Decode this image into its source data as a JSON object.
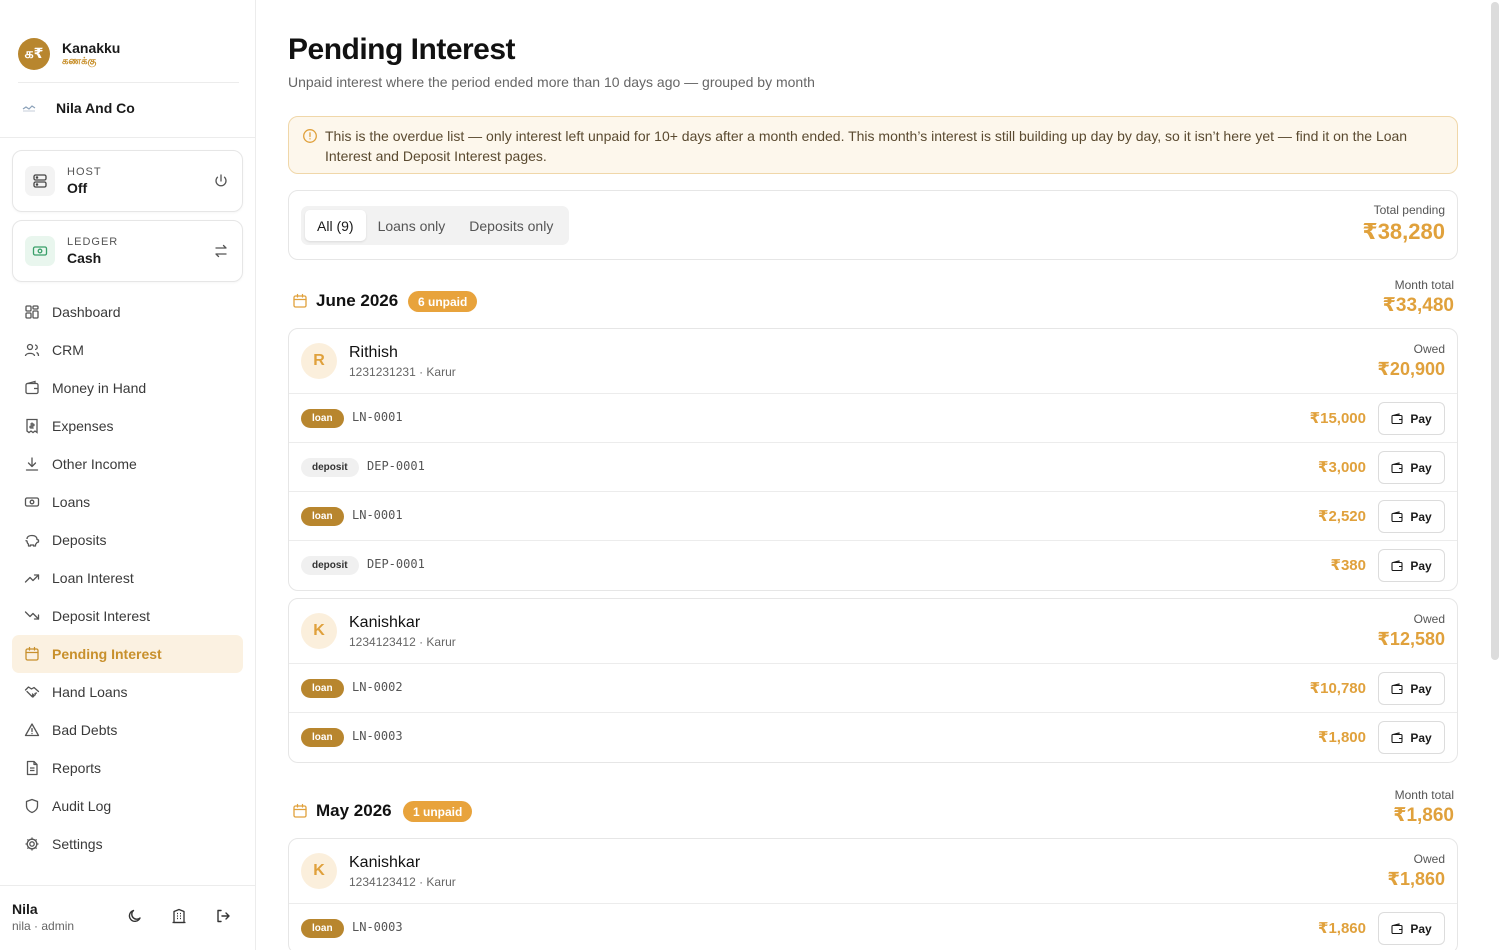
{
  "brand": {
    "logo_glyph": "க₹",
    "name": "Kanakku",
    "subtitle": "கணக்கு"
  },
  "org": {
    "name": "Nila And Co"
  },
  "host": {
    "label": "HOST",
    "value": "Off"
  },
  "ledger": {
    "label": "LEDGER",
    "value": "Cash"
  },
  "nav": [
    {
      "label": "Dashboard",
      "icon": "grid-icon"
    },
    {
      "label": "CRM",
      "icon": "users-icon"
    },
    {
      "label": "Money in Hand",
      "icon": "wallet-icon"
    },
    {
      "label": "Expenses",
      "icon": "receipt-icon"
    },
    {
      "label": "Other Income",
      "icon": "download-icon"
    },
    {
      "label": "Loans",
      "icon": "banknote-icon"
    },
    {
      "label": "Deposits",
      "icon": "piggy-bank-icon"
    },
    {
      "label": "Loan Interest",
      "icon": "trending-up-icon"
    },
    {
      "label": "Deposit Interest",
      "icon": "trending-down-icon"
    },
    {
      "label": "Pending Interest",
      "icon": "calendar-icon",
      "active": true
    },
    {
      "label": "Hand Loans",
      "icon": "handshake-icon"
    },
    {
      "label": "Bad Debts",
      "icon": "alert-triangle-icon"
    },
    {
      "label": "Reports",
      "icon": "file-text-icon"
    },
    {
      "label": "Audit Log",
      "icon": "shield-icon"
    },
    {
      "label": "Settings",
      "icon": "gear-icon"
    }
  ],
  "user": {
    "name": "Nila",
    "role": "nila · admin"
  },
  "page": {
    "title": "Pending Interest",
    "subtitle": "Unpaid interest where the period ended more than 10 days ago — grouped by month",
    "notice": "This is the overdue list — only interest left unpaid for 10+ days after a month ended. This month’s interest is still building up day by day, so it isn’t here yet — find it on the Loan Interest and Deposit Interest pages."
  },
  "filters": {
    "all": "All (9)",
    "loans": "Loans only",
    "deposits": "Deposits only"
  },
  "total": {
    "label": "Total pending",
    "value": "₹38,280"
  },
  "labels": {
    "month_total": "Month total",
    "owed": "Owed",
    "pay": "Pay"
  },
  "months": [
    {
      "title": "June 2026",
      "badge": "6 unpaid",
      "total": "₹33,480",
      "people": [
        {
          "initial": "R",
          "name": "Rithish",
          "meta": "1231231231 · Karur",
          "owed": "₹20,900",
          "rows": [
            {
              "type": "loan",
              "ref": "LN-0001",
              "amount": "₹15,000"
            },
            {
              "type": "deposit",
              "ref": "DEP-0001",
              "amount": "₹3,000"
            },
            {
              "type": "loan",
              "ref": "LN-0001",
              "amount": "₹2,520"
            },
            {
              "type": "deposit",
              "ref": "DEP-0001",
              "amount": "₹380"
            }
          ]
        },
        {
          "initial": "K",
          "name": "Kanishkar",
          "meta": "1234123412 · Karur",
          "owed": "₹12,580",
          "rows": [
            {
              "type": "loan",
              "ref": "LN-0002",
              "amount": "₹10,780"
            },
            {
              "type": "loan",
              "ref": "LN-0003",
              "amount": "₹1,800"
            }
          ]
        }
      ]
    },
    {
      "title": "May 2026",
      "badge": "1 unpaid",
      "total": "₹1,860",
      "people": [
        {
          "initial": "K",
          "name": "Kanishkar",
          "meta": "1234123412 · Karur",
          "owed": "₹1,860",
          "rows": [
            {
              "type": "loan",
              "ref": "LN-0003",
              "amount": "₹1,860"
            }
          ]
        }
      ]
    }
  ]
}
